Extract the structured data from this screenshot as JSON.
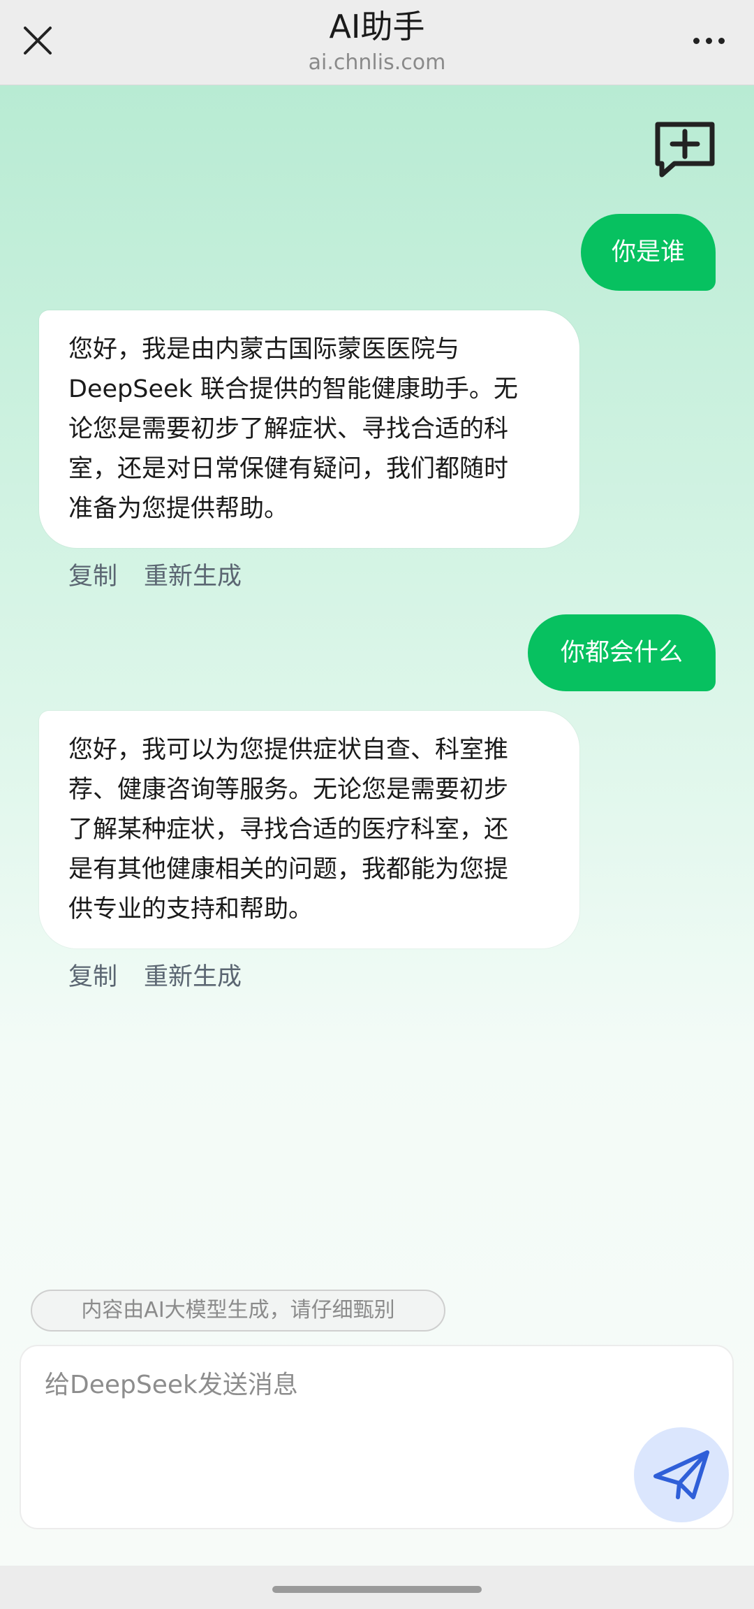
{
  "header": {
    "title": "AI助手",
    "subtitle": "ai.chnlis.com",
    "close_icon": "close-icon",
    "more_icon": "more-icon"
  },
  "chat": {
    "new_chat_icon": "new-chat-icon",
    "messages": [
      {
        "role": "user",
        "text": "你是谁"
      },
      {
        "role": "assistant",
        "lines": [
          "您好，我是由内蒙古国际蒙医医院与",
          "DeepSeek 联合提供的智能健康助手。无",
          "论您是需要初步了解症状、寻找合适的科",
          "室，还是对日常保健有疑问，我们都随时",
          "准备为您提供帮助。"
        ]
      },
      {
        "role": "user",
        "text": "你都会什么"
      },
      {
        "role": "assistant",
        "lines": [
          "您好，我可以为您提供症状自查、科室推",
          "荐、健康咨询等服务。无论您是需要初步",
          "了解某种症状，寻找合适的医疗科室，还",
          "是有其他健康相关的问题，我都能为您提",
          "供专业的支持和帮助。"
        ]
      }
    ],
    "actions": {
      "copy": "复制",
      "regenerate": "重新生成"
    }
  },
  "footer": {
    "disclaimer": "内容由AI大模型生成，请仔细甄别",
    "input_placeholder": "给DeepSeek发送消息",
    "send_icon": "send-icon"
  },
  "colors": {
    "user_bubble": "#07c160",
    "send_icon": "#2f5fd8",
    "background_top": "#b8ebd3"
  }
}
